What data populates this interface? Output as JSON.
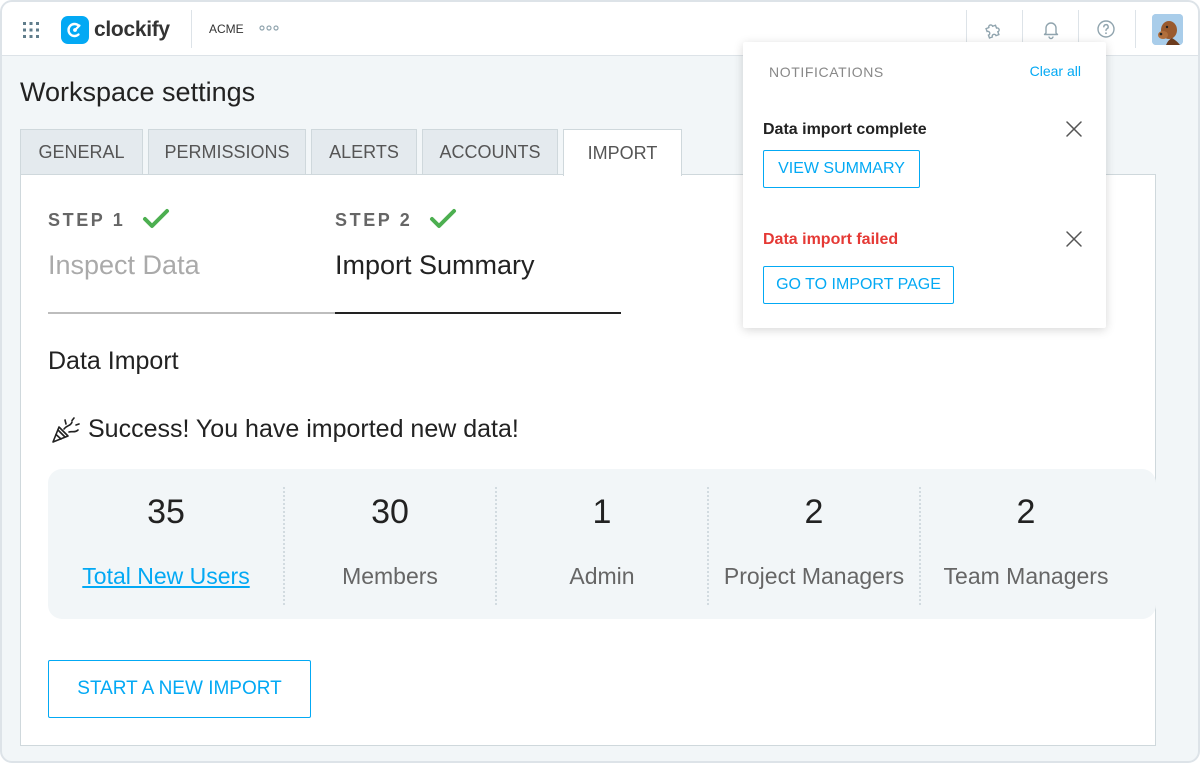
{
  "colors": {
    "accent": "#03a9f4",
    "success": "#4caf50",
    "error": "#e53935"
  },
  "topbar": {
    "app_name": "clockify",
    "workspace": "ACME",
    "icons": [
      "apps-grid-icon",
      "more-horizontal-icon",
      "puzzle-icon",
      "bell-icon",
      "help-icon"
    ]
  },
  "page": {
    "title": "Workspace settings",
    "tabs": [
      {
        "label": "GENERAL",
        "active": false
      },
      {
        "label": "PERMISSIONS",
        "active": false
      },
      {
        "label": "ALERTS",
        "active": false
      },
      {
        "label": "ACCOUNTS",
        "active": false
      },
      {
        "label": "IMPORT",
        "active": true
      }
    ]
  },
  "steps": [
    {
      "label": "STEP 1",
      "name": "Inspect Data",
      "completed": true,
      "current": false
    },
    {
      "label": "STEP 2",
      "name": "Import Summary",
      "completed": true,
      "current": true
    }
  ],
  "import": {
    "section_title": "Data Import",
    "success_message": "Success! You have imported new data!",
    "stats": [
      {
        "value": "35",
        "label": "Total New Users",
        "link": true
      },
      {
        "value": "30",
        "label": "Members",
        "link": false
      },
      {
        "value": "1",
        "label": "Admin",
        "link": false
      },
      {
        "value": "2",
        "label": "Project Managers",
        "link": false
      },
      {
        "value": "2",
        "label": "Team Managers",
        "link": false
      }
    ],
    "new_import_button": "START A NEW IMPORT"
  },
  "notifications": {
    "header": "NOTIFICATIONS",
    "clear_all": "Clear all",
    "items": [
      {
        "title": "Data import complete",
        "status": "success",
        "action": "VIEW SUMMARY"
      },
      {
        "title": "Data import failed",
        "status": "error",
        "action": "GO TO IMPORT PAGE"
      }
    ]
  }
}
